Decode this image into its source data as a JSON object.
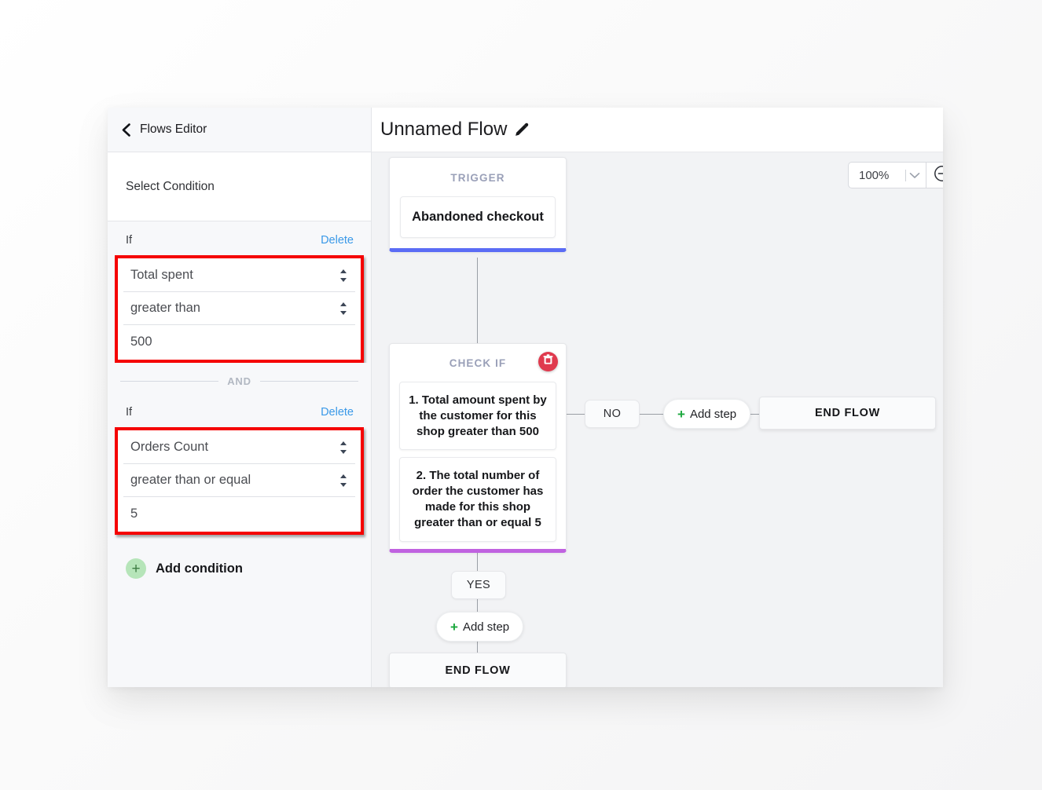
{
  "sidebar": {
    "back_label": "Flows Editor",
    "back_icon": "chevron-left-icon",
    "select_condition_label": "Select Condition",
    "conditions": [
      {
        "if_label": "If",
        "delete_label": "Delete",
        "field_label": "Total spent",
        "operator": "greater than",
        "value": "500",
        "highlighted": true
      },
      {
        "if_label": "If",
        "delete_label": "Delete",
        "field_label": "Orders Count",
        "operator": "greater than or equal",
        "value": "5",
        "highlighted": true
      }
    ],
    "join_operator": "AND",
    "add_condition_label": "Add condition",
    "add_condition_icon": "plus-circle-icon"
  },
  "main": {
    "flow_title": "Unnamed Flow",
    "edit_icon": "pencil-icon",
    "zoom": {
      "value": "100%",
      "chevron_icon": "chevron-down-icon",
      "zoom_out_icon": "minus-circle-icon"
    },
    "nodes": {
      "trigger": {
        "kicker": "TRIGGER",
        "item": "Abandoned checkout",
        "accent_color": "#5b6cf5"
      },
      "check_if": {
        "kicker": "CHECK IF",
        "delete_icon": "trash-icon",
        "delete_color": "#e03a4e",
        "items": [
          "1. Total amount spent by the customer for this shop greater than 500",
          "2. The total number of order the customer has made for this shop greater than or equal 5"
        ],
        "accent_color": "#c062e0"
      }
    },
    "branches": {
      "no_label": "NO",
      "yes_label": "YES",
      "add_step_label": "Add step",
      "add_step_icon": "plus-icon",
      "end_flow_label": "END FLOW"
    }
  }
}
